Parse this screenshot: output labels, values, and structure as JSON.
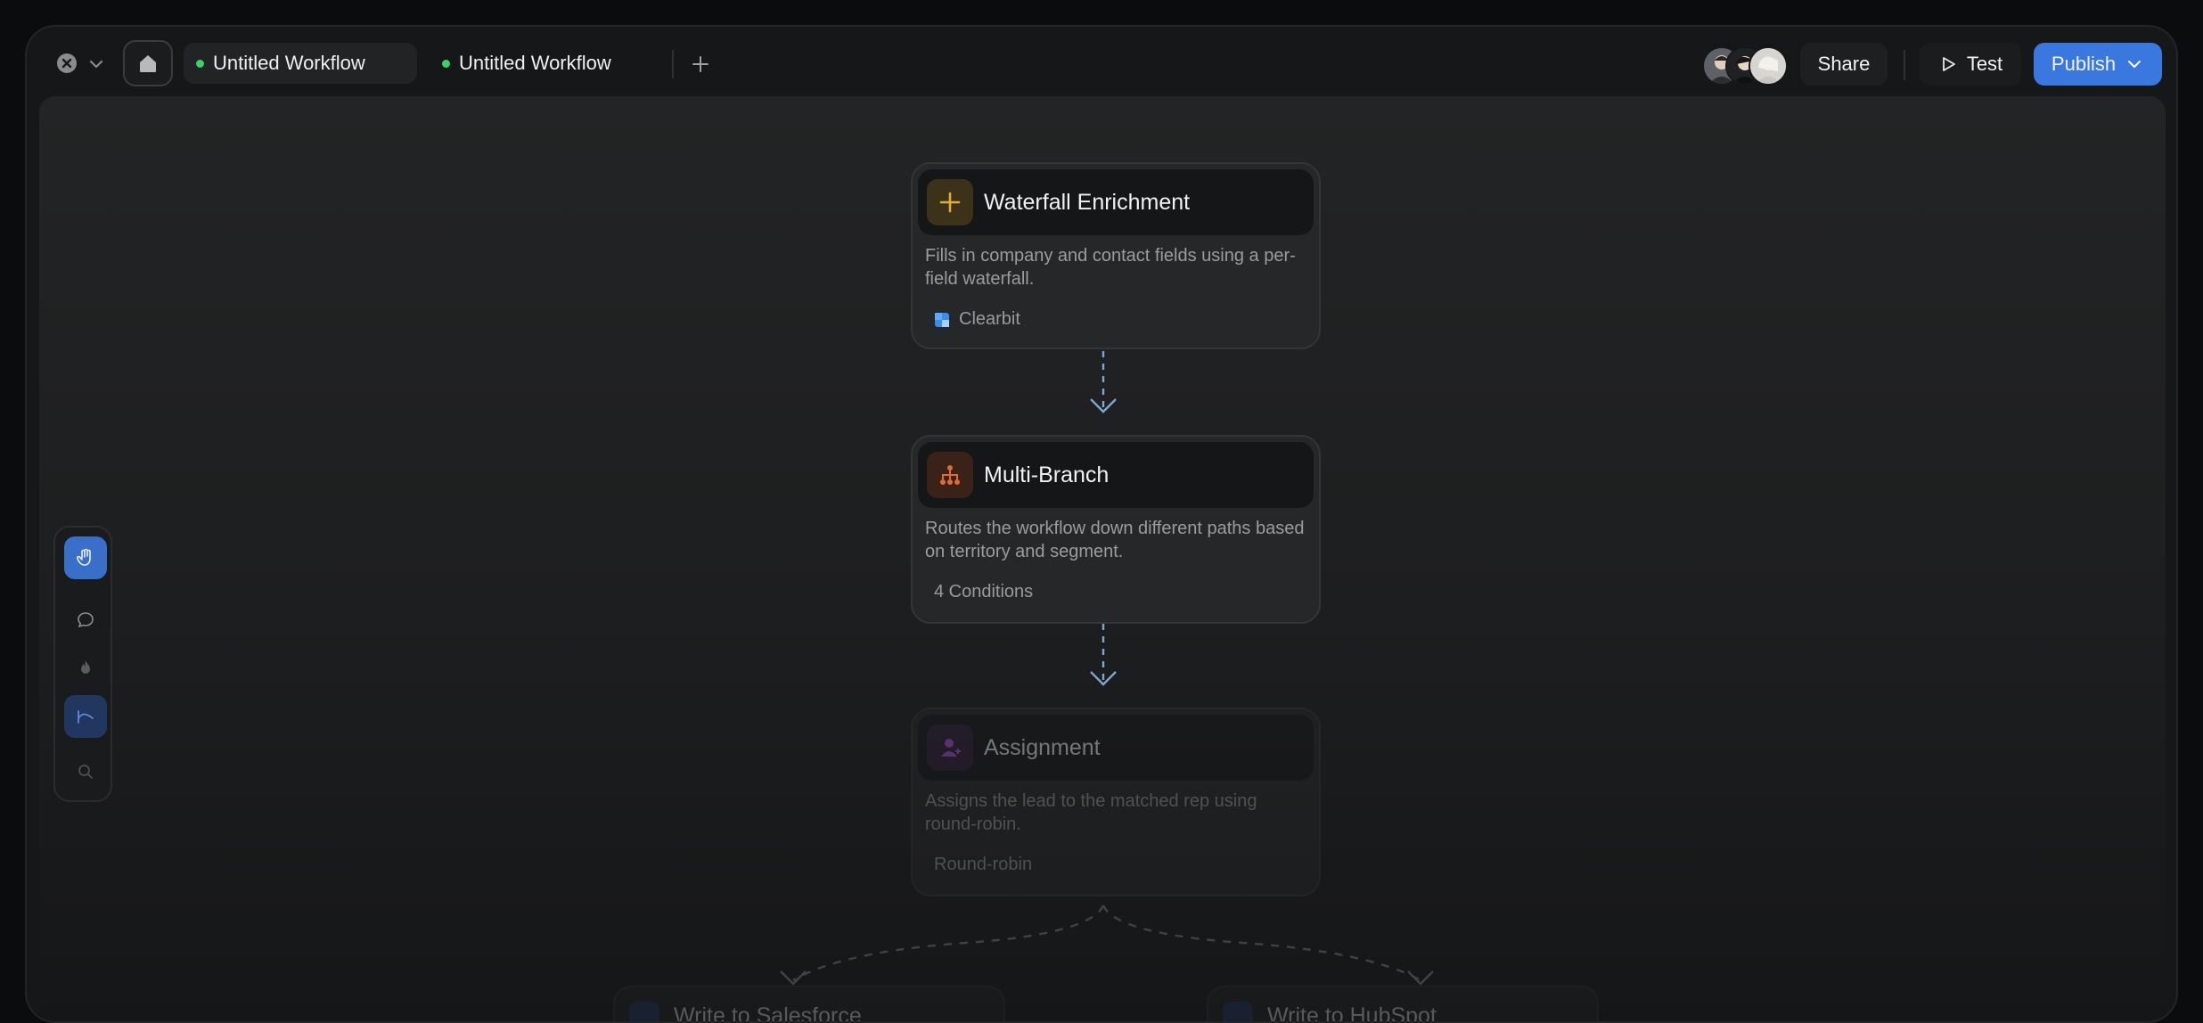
{
  "tabs": [
    {
      "label": "Untitled Workflow",
      "active": true
    },
    {
      "label": "Untitled Workflow",
      "active": false
    }
  ],
  "header": {
    "share_label": "Share",
    "test_label": "Test",
    "publish_label": "Publish"
  },
  "nodes": [
    {
      "title": "Waterfall Enrichment",
      "description": "Fills in company and contact fields using a per-field waterfall.",
      "footer": "Clearbit",
      "icon": "plus-icon"
    },
    {
      "title": "Multi-Branch",
      "description": "Routes the workflow down different paths based on territory and segment.",
      "footer": "4 Conditions",
      "icon": "branch-icon"
    },
    {
      "title": "Assignment",
      "description": "Assigns the lead to the matched rep using round-robin.",
      "footer": "Round-robin",
      "icon": "user-assign-icon"
    }
  ],
  "branches": [
    {
      "label": "Write to Salesforce"
    },
    {
      "label": "Write to HubSpot"
    }
  ],
  "toolbar": [
    "hand-icon",
    "comment-icon",
    "fire-icon",
    "trend-icon",
    "search-icon"
  ],
  "colors": {
    "accent": "#3a78df",
    "status_dot": "#3ecf6e",
    "connector": "#7da6d1"
  }
}
